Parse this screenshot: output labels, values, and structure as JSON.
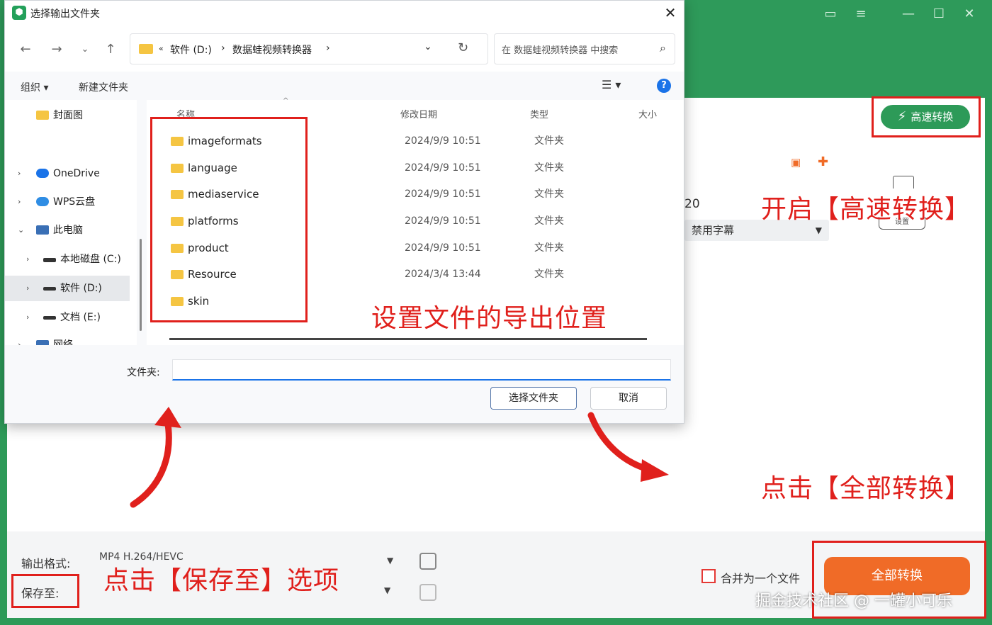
{
  "app": {
    "fast_convert_label": "高速转换",
    "number_text": "20",
    "subtitle_select": "禁用字幕",
    "settings_label": "设置",
    "output_format_label": "输出格式:",
    "output_format_value": "MP4 H.264/HEVC",
    "save_to_label": "保存至:",
    "merge_label": "合并为一个文件",
    "convert_all_label": "全部转换"
  },
  "dialog": {
    "title": "选择输出文件夹",
    "address_parts": [
      "«",
      "软件 (D:)",
      "›",
      "数据蛙视频转换器",
      "›"
    ],
    "search_placeholder": "在 数据蛙视频转换器 中搜索",
    "toolbar": {
      "organize_label": "组织 ▾",
      "new_folder_label": "新建文件夹"
    },
    "nav_items": [
      {
        "label": "封面图"
      },
      {
        "label": "OneDrive"
      },
      {
        "label": "WPS云盘"
      },
      {
        "label": "此电脑"
      },
      {
        "label": "本地磁盘 (C:)"
      },
      {
        "label": "软件 (D:)"
      },
      {
        "label": "文档 (E:)"
      },
      {
        "label": "网络"
      }
    ],
    "columns": {
      "name": "名称",
      "modified": "修改日期",
      "type": "类型",
      "size": "大小"
    },
    "files": [
      {
        "name": "imageformats",
        "modified": "2024/9/9 10:51",
        "type": "文件夹"
      },
      {
        "name": "language",
        "modified": "2024/9/9 10:51",
        "type": "文件夹"
      },
      {
        "name": "mediaservice",
        "modified": "2024/9/9 10:51",
        "type": "文件夹"
      },
      {
        "name": "platforms",
        "modified": "2024/9/9 10:51",
        "type": "文件夹"
      },
      {
        "name": "product",
        "modified": "2024/9/9 10:51",
        "type": "文件夹"
      },
      {
        "name": "Resource",
        "modified": "2024/3/4 13:44",
        "type": "文件夹"
      },
      {
        "name": "skin",
        "modified": "",
        "type": ""
      }
    ],
    "folder_label": "文件夹:",
    "folder_value": "",
    "select_button": "选择文件夹",
    "cancel_button": "取消"
  },
  "annotations": {
    "export_location": "设置文件的导出位置",
    "enable_fast": "开启【高速转换】",
    "click_convert_all": "点击【全部转换】",
    "click_save_to": "点击【保存至】选项"
  },
  "watermark": "掘金技术社区 @ 一罐小可乐",
  "colors": {
    "brand_green": "#2d9a58",
    "convert_orange": "#f06b27",
    "annotation_red": "#e0201c",
    "link_blue": "#1a73e8"
  }
}
